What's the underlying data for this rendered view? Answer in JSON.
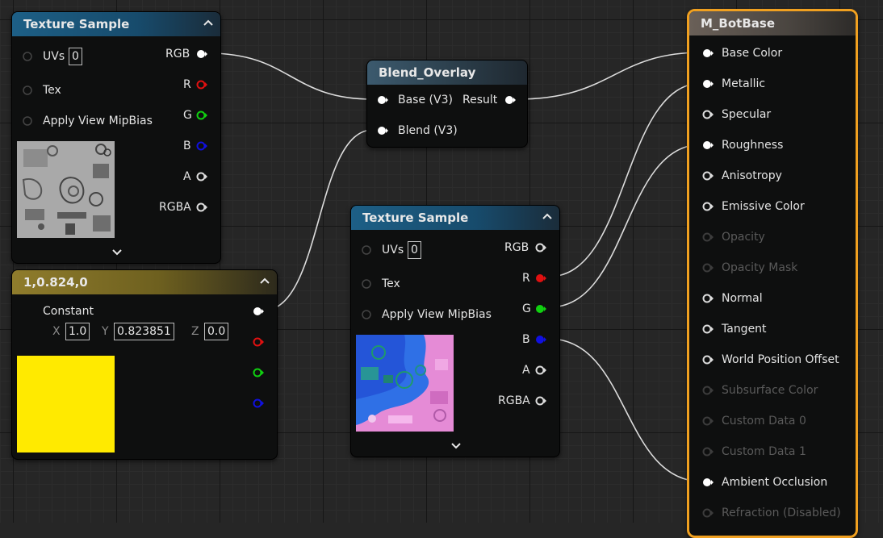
{
  "nodes": {
    "tex1": {
      "title": "Texture Sample",
      "inputs": [
        "UVs",
        "Tex",
        "Apply View MipBias"
      ],
      "uvs_value": "0",
      "outputs": [
        "RGB",
        "R",
        "G",
        "B",
        "A",
        "RGBA"
      ]
    },
    "constant": {
      "title": "1,0.824,0",
      "label": "Constant",
      "x_label": "X",
      "x_value": "1.0",
      "y_label": "Y",
      "y_value": "0.823851",
      "z_label": "Z",
      "z_value": "0.0",
      "swatch_color": "#ffea00"
    },
    "blend": {
      "title": "Blend_Overlay",
      "inputs": [
        "Base (V3)",
        "Blend (V3)"
      ],
      "output": "Result"
    },
    "tex2": {
      "title": "Texture Sample",
      "inputs": [
        "UVs",
        "Tex",
        "Apply View MipBias"
      ],
      "uvs_value": "0",
      "outputs": [
        "RGB",
        "R",
        "G",
        "B",
        "A",
        "RGBA"
      ]
    },
    "result": {
      "title": "M_BotBase",
      "pins": [
        "Base Color",
        "Metallic",
        "Specular",
        "Roughness",
        "Anisotropy",
        "Emissive Color",
        "Opacity",
        "Opacity Mask",
        "Normal",
        "Tangent",
        "World Position Offset",
        "Subsurface Color",
        "Custom Data 0",
        "Custom Data 1",
        "Ambient Occlusion",
        "Refraction (Disabled)"
      ]
    }
  },
  "colors": {
    "pin_white": "#ffffff",
    "pin_red": "#e01010",
    "pin_green": "#10d010",
    "pin_blue": "#1010e0",
    "selection": "#f0a020"
  }
}
